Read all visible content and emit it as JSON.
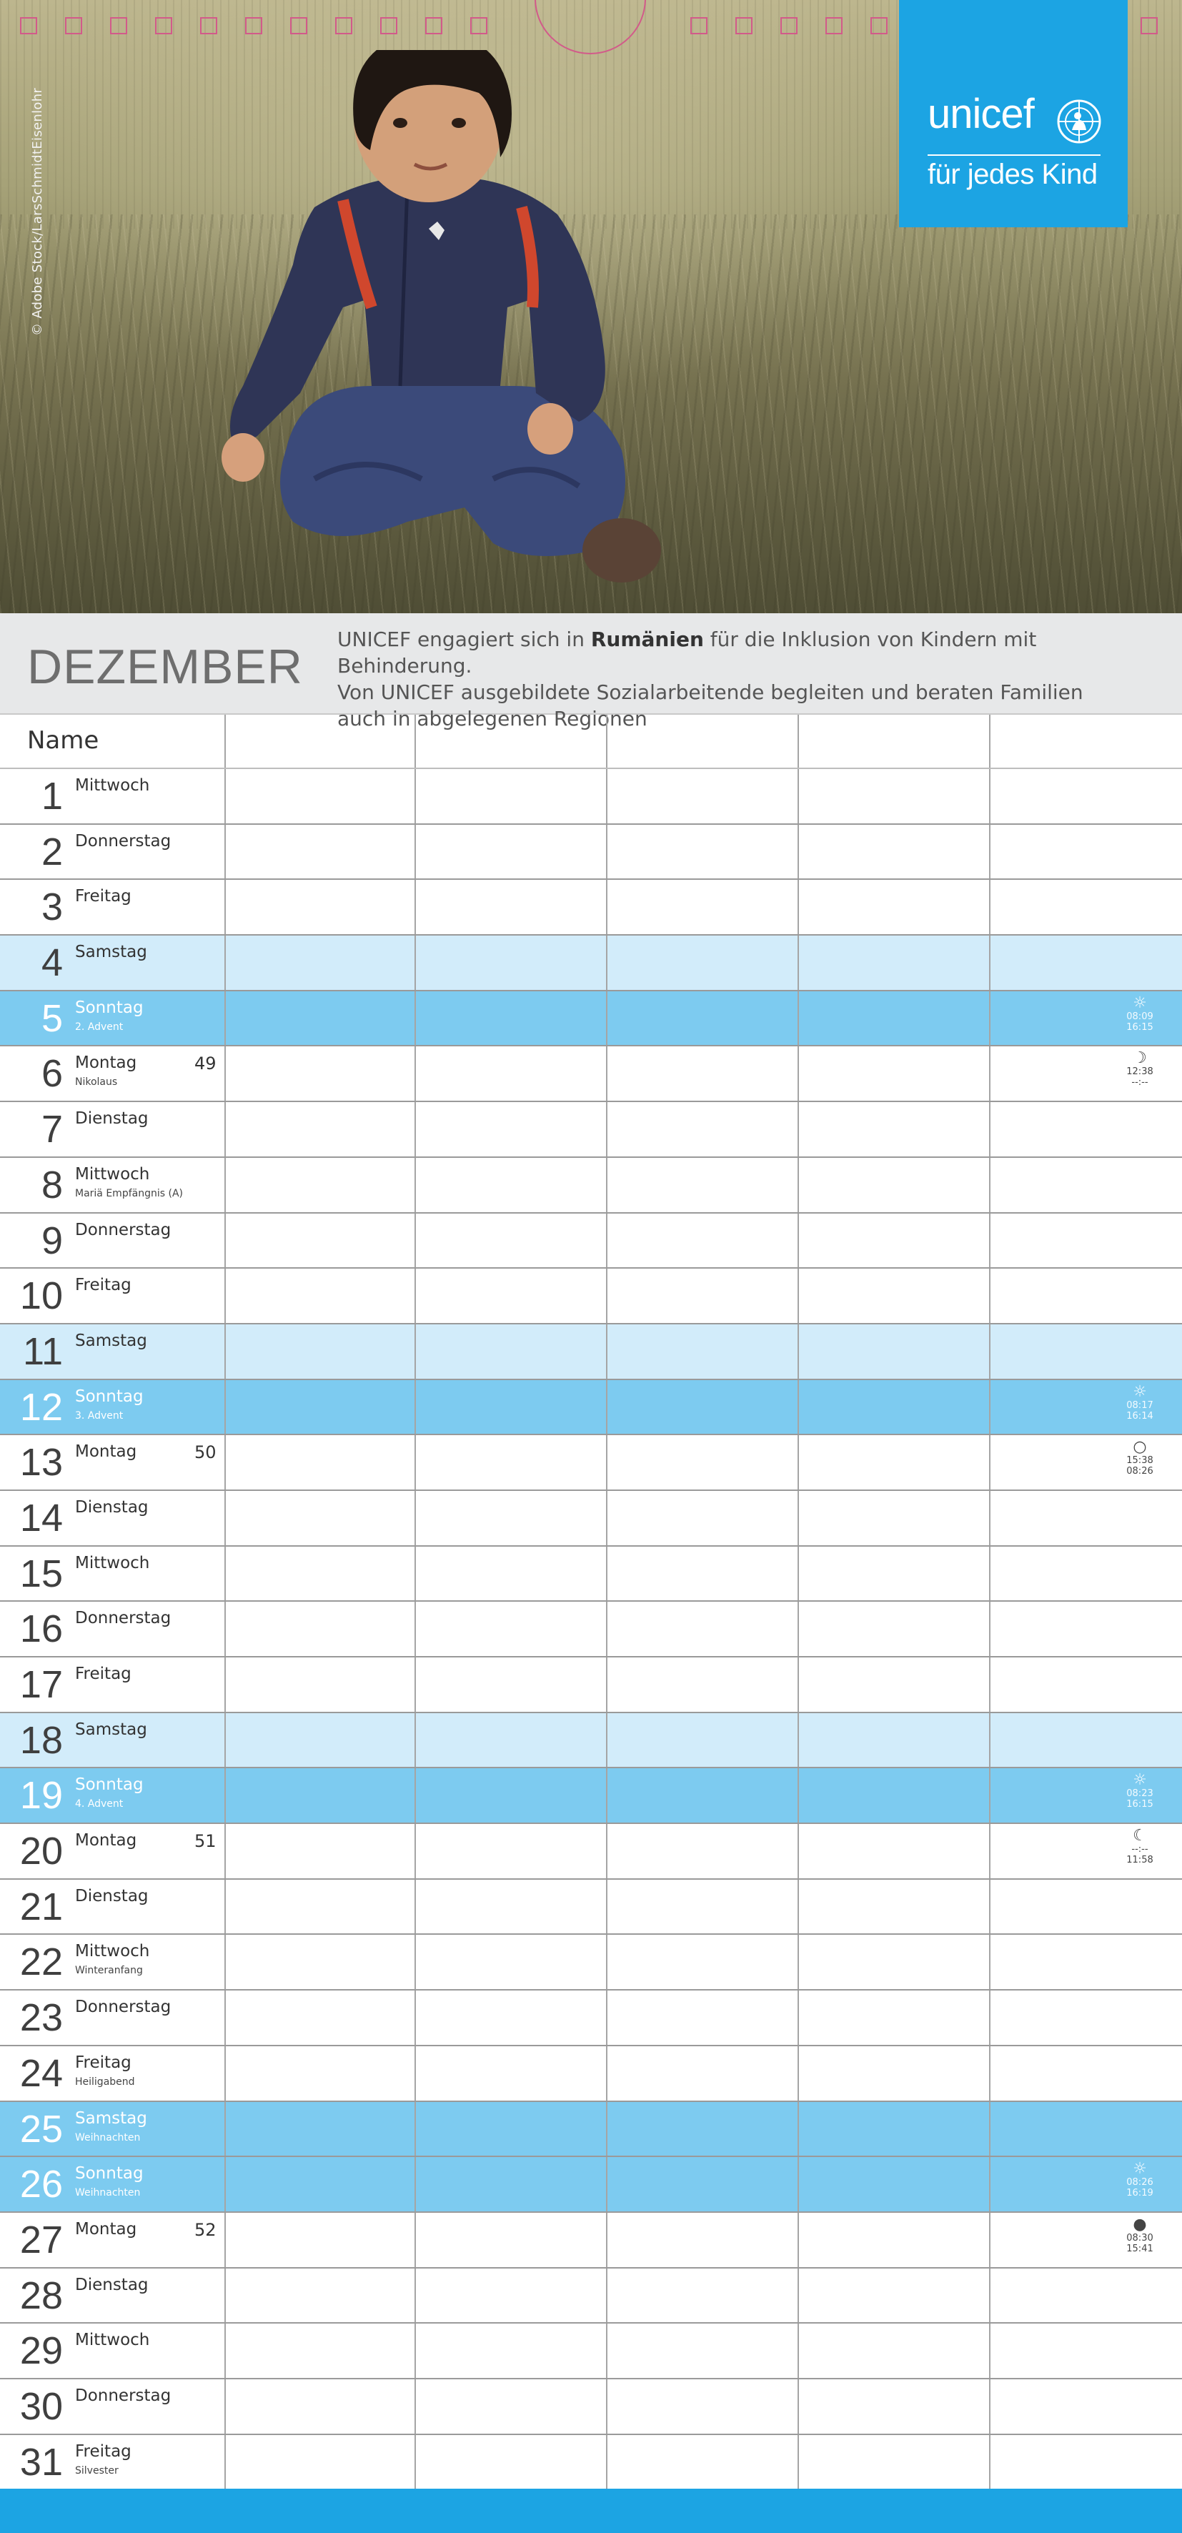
{
  "photo": {
    "copyright": "© Adobe Stock/LarsSchmidtEisenlohr",
    "brand": {
      "wordmark": "unicef",
      "tagline": "für jedes Kind",
      "color": "#1ca4e3"
    }
  },
  "header": {
    "month": "DEZEMBER",
    "description_parts": [
      {
        "text": "UNICEF engagiert sich in ",
        "bold": false
      },
      {
        "text": "Rumänien",
        "bold": true
      },
      {
        "text": " für die Inklusion von Kindern mit Behinderung.",
        "bold": false
      },
      {
        "text": "\n",
        "bold": false
      },
      {
        "text": "Von UNICEF ausgebildete Sozialarbeitende begleiten und beraten Familien",
        "bold": false
      },
      {
        "text": "\n",
        "bold": false
      },
      {
        "text": "auch in abgelegenen Regionen",
        "bold": false
      }
    ]
  },
  "grid": {
    "name_label": "Name",
    "colors": {
      "saturday": "#d2ecfa",
      "sunday": "#7dcbf0"
    },
    "days": [
      {
        "n": "1",
        "wd": "Mittwoch"
      },
      {
        "n": "2",
        "wd": "Donnerstag"
      },
      {
        "n": "3",
        "wd": "Freitag"
      },
      {
        "n": "4",
        "wd": "Samstag",
        "type": "sat"
      },
      {
        "n": "5",
        "wd": "Sonntag",
        "hol": "2. Advent",
        "type": "sun",
        "astro": {
          "icon": "sun-icon",
          "sym": "☼",
          "l1": "08:09",
          "l2": "16:15"
        }
      },
      {
        "n": "6",
        "wd": "Montag",
        "hol": "Nikolaus",
        "kw": "49",
        "astro": {
          "icon": "moon-first-quarter-icon",
          "sym": "☽",
          "l1": "12:38",
          "l2": "--:--"
        }
      },
      {
        "n": "7",
        "wd": "Dienstag"
      },
      {
        "n": "8",
        "wd": "Mittwoch",
        "hol": "Mariä Empfängnis (A)"
      },
      {
        "n": "9",
        "wd": "Donnerstag"
      },
      {
        "n": "10",
        "wd": "Freitag"
      },
      {
        "n": "11",
        "wd": "Samstag",
        "type": "sat"
      },
      {
        "n": "12",
        "wd": "Sonntag",
        "hol": "3. Advent",
        "type": "sun",
        "astro": {
          "icon": "sun-icon",
          "sym": "☼",
          "l1": "08:17",
          "l2": "16:14"
        }
      },
      {
        "n": "13",
        "wd": "Montag",
        "kw": "50",
        "astro": {
          "icon": "full-moon-icon",
          "sym": "○",
          "l1": "15:38",
          "l2": "08:26"
        }
      },
      {
        "n": "14",
        "wd": "Dienstag"
      },
      {
        "n": "15",
        "wd": "Mittwoch"
      },
      {
        "n": "16",
        "wd": "Donnerstag"
      },
      {
        "n": "17",
        "wd": "Freitag"
      },
      {
        "n": "18",
        "wd": "Samstag",
        "type": "sat"
      },
      {
        "n": "19",
        "wd": "Sonntag",
        "hol": "4. Advent",
        "type": "sun",
        "astro": {
          "icon": "sun-icon",
          "sym": "☼",
          "l1": "08:23",
          "l2": "16:15"
        }
      },
      {
        "n": "20",
        "wd": "Montag",
        "kw": "51",
        "astro": {
          "icon": "moon-last-quarter-icon",
          "sym": "☾",
          "l1": "--:--",
          "l2": "11:58"
        }
      },
      {
        "n": "21",
        "wd": "Dienstag"
      },
      {
        "n": "22",
        "wd": "Mittwoch",
        "hol": "Winteranfang"
      },
      {
        "n": "23",
        "wd": "Donnerstag"
      },
      {
        "n": "24",
        "wd": "Freitag",
        "hol": "Heiligabend"
      },
      {
        "n": "25",
        "wd": "Samstag",
        "hol": "Weihnachten",
        "type": "sun"
      },
      {
        "n": "26",
        "wd": "Sonntag",
        "hol": "Weihnachten",
        "type": "sun",
        "astro": {
          "icon": "sun-icon",
          "sym": "☼",
          "l1": "08:26",
          "l2": "16:19"
        }
      },
      {
        "n": "27",
        "wd": "Montag",
        "kw": "52",
        "astro": {
          "icon": "new-moon-icon",
          "sym": "●",
          "l1": "08:30",
          "l2": "15:41"
        }
      },
      {
        "n": "28",
        "wd": "Dienstag"
      },
      {
        "n": "29",
        "wd": "Mittwoch"
      },
      {
        "n": "30",
        "wd": "Donnerstag"
      },
      {
        "n": "31",
        "wd": "Freitag",
        "hol": "Silvester"
      }
    ]
  }
}
